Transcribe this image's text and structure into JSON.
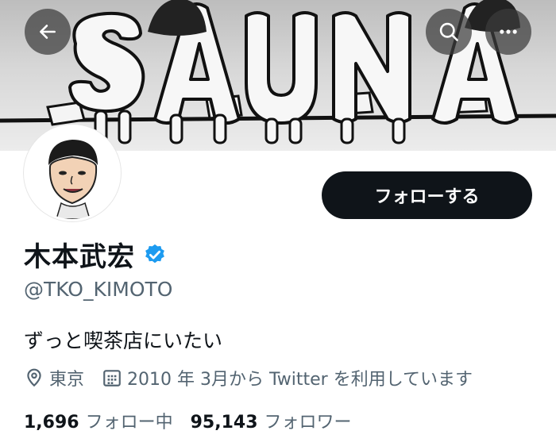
{
  "header": {
    "banner_text": "SAUNA"
  },
  "profile": {
    "name": "木本武宏",
    "handle": "@TKO_KIMOTO",
    "bio": "ずっと喫茶店にいたい",
    "location": "東京",
    "joined": "2010 年 3月から Twitter を利用しています",
    "follow_label": "フォローする"
  },
  "stats": {
    "following_count": "1,696",
    "following_label": "フォロー中",
    "followers_count": "95,143",
    "followers_label": "フォロワー"
  },
  "colors": {
    "verified": "#1d9bf0",
    "follow_button": "#0f1419",
    "secondary_text": "#536471"
  },
  "icons": {
    "back": "arrow-left-icon",
    "search": "search-icon",
    "more": "more-dots-icon",
    "location": "map-pin-icon",
    "calendar": "calendar-icon",
    "verified": "verified-badge-icon"
  }
}
